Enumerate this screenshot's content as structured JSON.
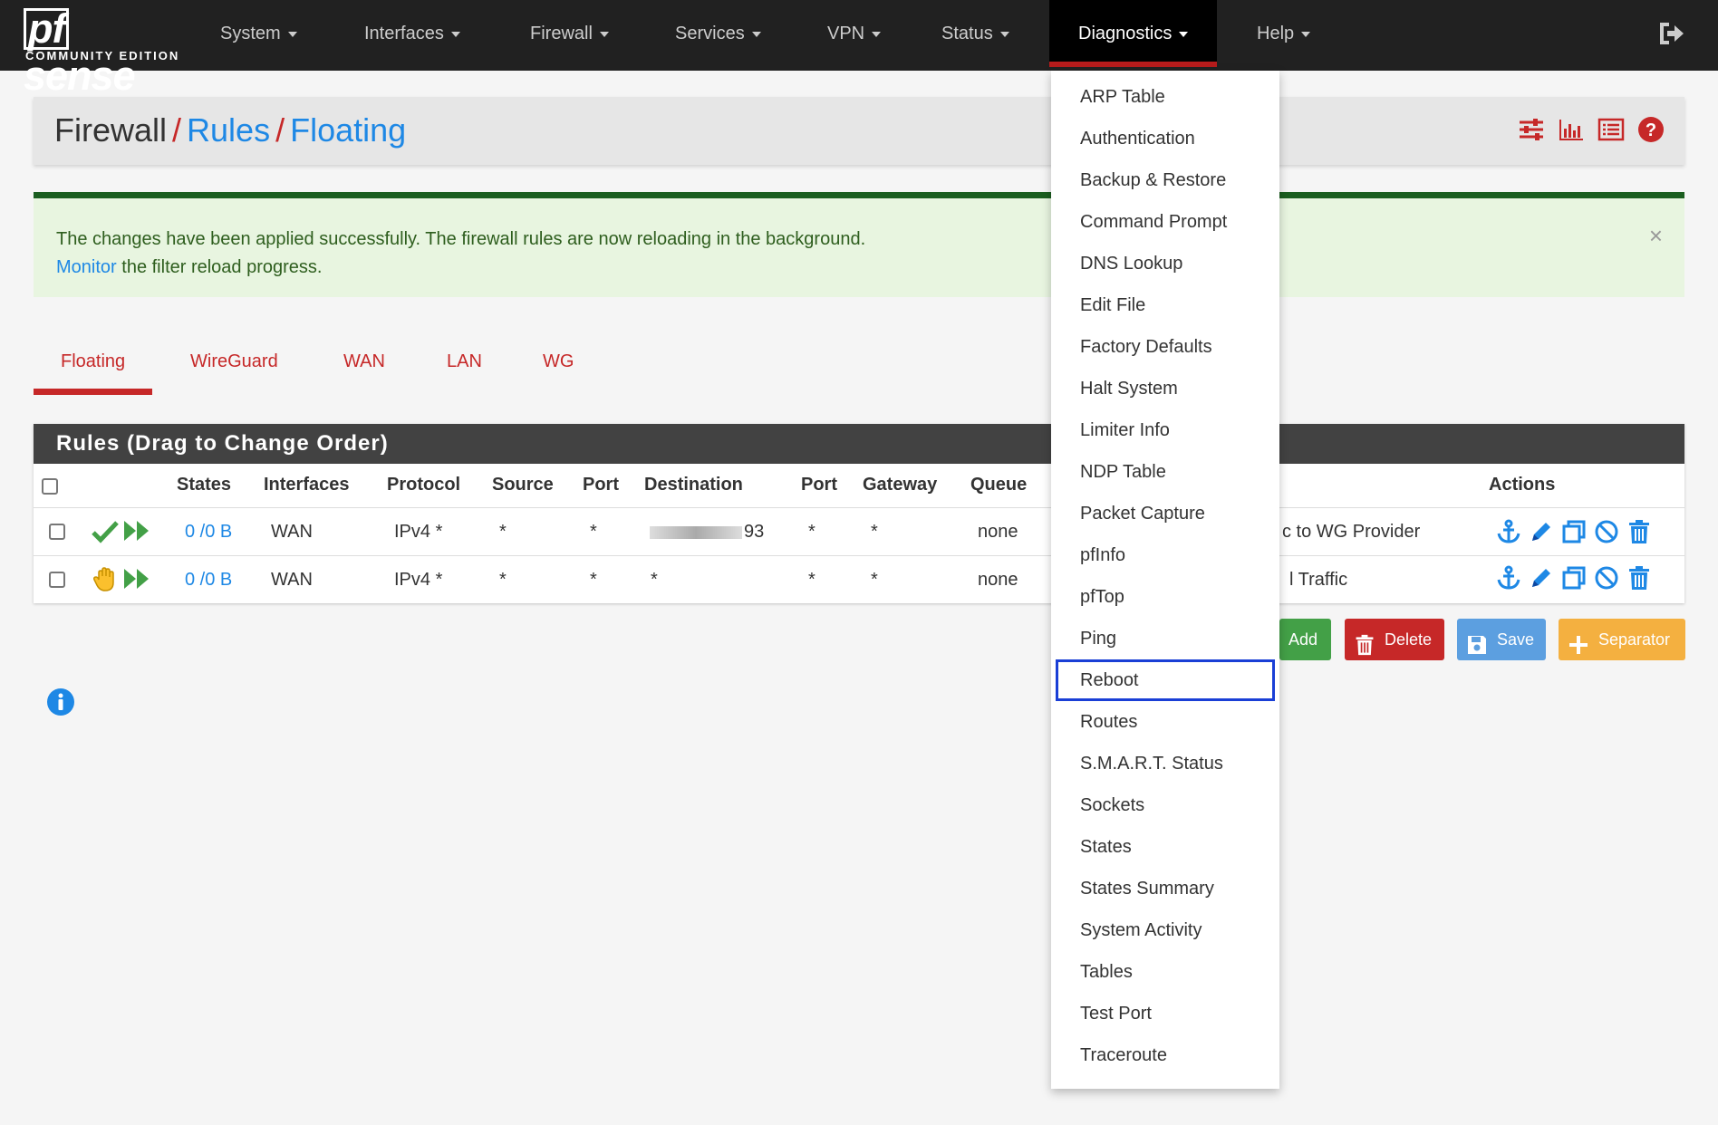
{
  "brand": {
    "logo_pf": "pf",
    "logo_sense": "sense",
    "edition": "COMMUNITY EDITION"
  },
  "nav": {
    "items": [
      "System",
      "Interfaces",
      "Firewall",
      "Services",
      "VPN",
      "Status",
      "Diagnostics",
      "Help"
    ],
    "active": "Diagnostics"
  },
  "breadcrumb": {
    "root": "Firewall",
    "sep": "/",
    "level2": "Rules",
    "level3": "Floating"
  },
  "alert": {
    "message": "The changes have been applied successfully. The firewall rules are now reloading in the background.",
    "link": "Monitor",
    "message2": " the filter reload progress.",
    "close": "×"
  },
  "tabs": [
    "Floating",
    "WireGuard",
    "WAN",
    "LAN",
    "WG"
  ],
  "rules": {
    "title": "Rules (Drag to Change Order)",
    "headers": {
      "states": "States",
      "interfaces": "Interfaces",
      "protocol": "Protocol",
      "source": "Source",
      "port": "Port",
      "destination": "Destination",
      "dport": "Port",
      "gateway": "Gateway",
      "queue": "Queue",
      "actions": "Actions"
    },
    "rows": [
      {
        "states": "0 /0 B",
        "interface": "WAN",
        "protocol": "IPv4 *",
        "source": "*",
        "port": "*",
        "destination": "93",
        "dport": "*",
        "gateway": "*",
        "queue": "none",
        "description": "c to WG Provider"
      },
      {
        "states": "0 /0 B",
        "interface": "WAN",
        "protocol": "IPv4 *",
        "source": "*",
        "port": "*",
        "destination": "*",
        "dport": "*",
        "gateway": "*",
        "queue": "none",
        "description": "l Traffic"
      }
    ]
  },
  "buttons": {
    "add": "Add",
    "delete": "Delete",
    "save": "Save",
    "separator": "Separator"
  },
  "dropdown": {
    "items": [
      "ARP Table",
      "Authentication",
      "Backup & Restore",
      "Command Prompt",
      "DNS Lookup",
      "Edit File",
      "Factory Defaults",
      "Halt System",
      "Limiter Info",
      "NDP Table",
      "Packet Capture",
      "pfInfo",
      "pfTop",
      "Ping",
      "Reboot",
      "Routes",
      "S.M.A.R.T. Status",
      "Sockets",
      "States",
      "States Summary",
      "System Activity",
      "Tables",
      "Test Port",
      "Traceroute"
    ],
    "focused": "Reboot"
  },
  "colors": {
    "navbar": "#212121",
    "accent_red": "#c62828",
    "link_blue": "#1e88e5",
    "focus_blue": "#1a3fd6",
    "alert_green": "#1b5e20"
  }
}
